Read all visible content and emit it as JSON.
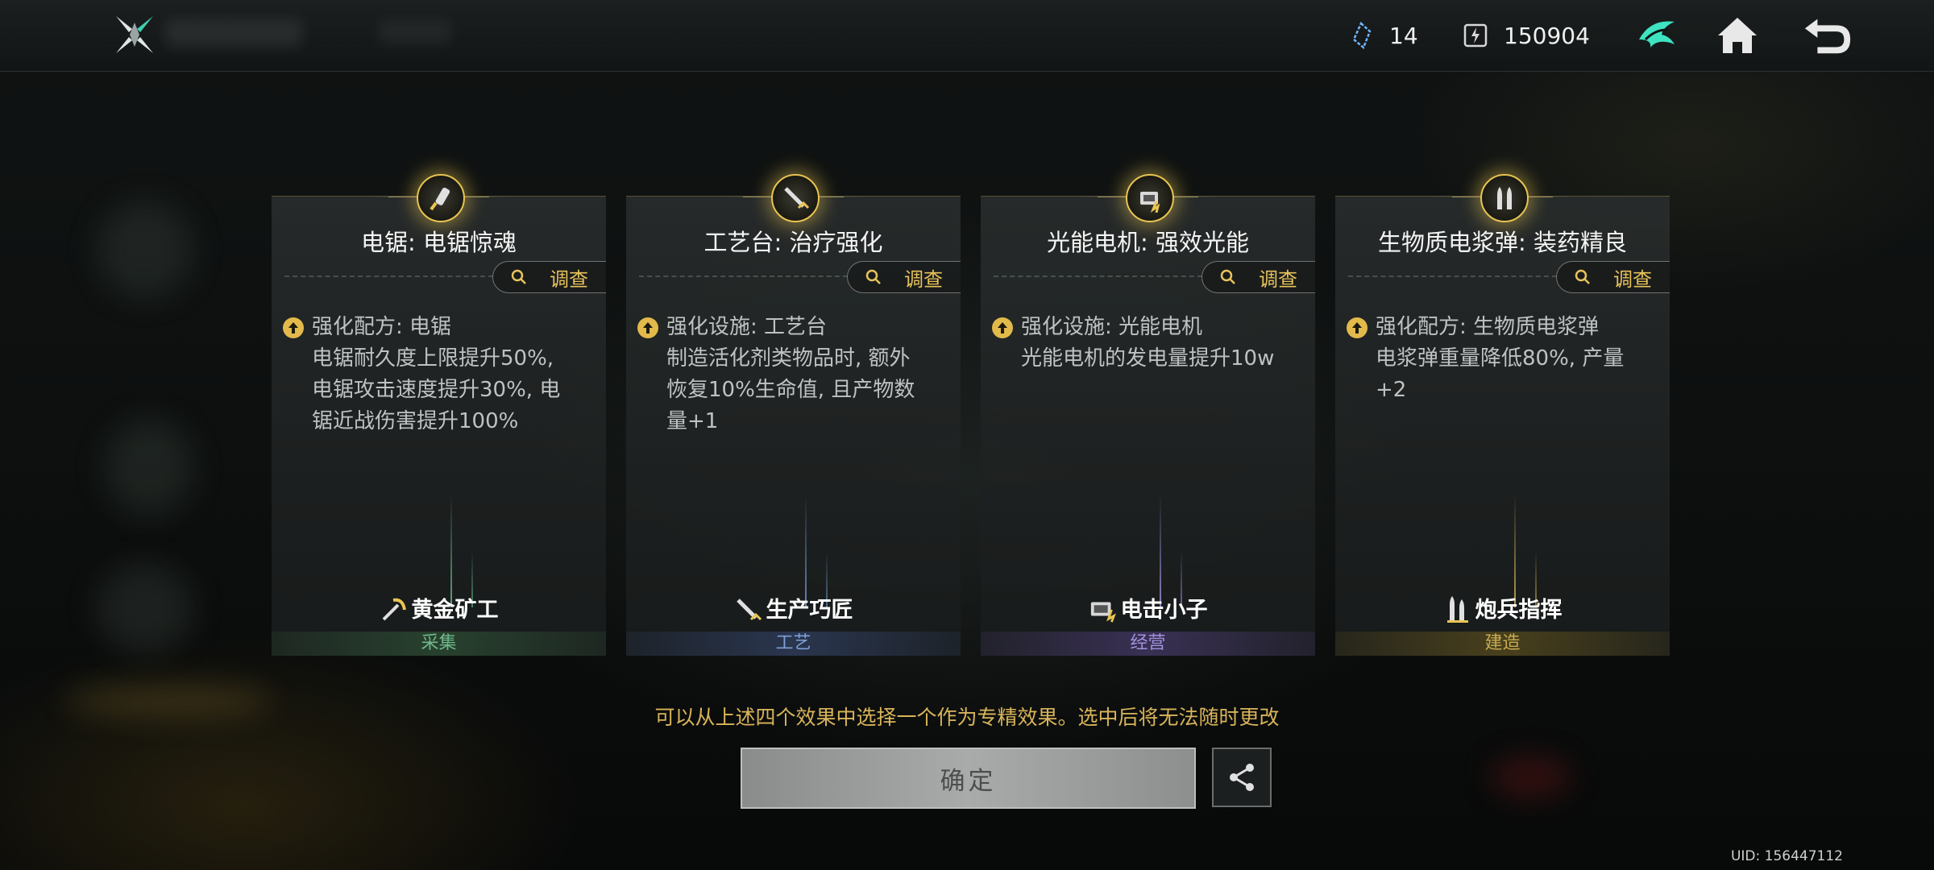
{
  "resources": [
    {
      "icon": "crystal-icon",
      "value": "14"
    },
    {
      "icon": "energy-card-icon",
      "value": "150904"
    }
  ],
  "nav": {
    "profile_icon": "emblem-icon",
    "home_icon": "home-icon",
    "back_icon": "back-arrow-icon"
  },
  "investigate_label": "调查",
  "cards": [
    {
      "title": "电锯: 电锯惊魂",
      "badge_icon": "chainsaw-icon",
      "effect_title": "强化配方: 电锯",
      "effect_body": "电锯耐久度上限提升50%,\n电锯攻击速度提升30%, 电\n锯近战伤害提升100%",
      "job": "黄金矿工",
      "job_icon": "pickaxe-icon",
      "category": "采集",
      "category_color": "#5fae7c"
    },
    {
      "title": "工艺台: 治疗强化",
      "badge_icon": "workbench-icon",
      "effect_title": "强化设施: 工艺台",
      "effect_body": "制造活化剂类物品时, 额外\n恢复10%生命值, 且产物数\n量+1",
      "job": "生产巧匠",
      "job_icon": "wrench-icon",
      "category": "工艺",
      "category_color": "#6f8fc9"
    },
    {
      "title": "光能电机: 强效光能",
      "badge_icon": "motor-icon",
      "effect_title": "强化设施: 光能电机",
      "effect_body": "光能电机的发电量提升10w",
      "job": "电击小子",
      "job_icon": "battery-icon",
      "category": "经营",
      "category_color": "#9a86d6"
    },
    {
      "title": "生物质电浆弹: 装药精良",
      "badge_icon": "bullets-icon",
      "effect_title": "强化配方: 生物质电浆弹",
      "effect_body": "电浆弹重量降低80%, 产量\n+2",
      "job": "炮兵指挥",
      "job_icon": "shells-icon",
      "category": "建造",
      "category_color": "#c2a64a"
    }
  ],
  "hint": "可以从上述四个效果中选择一个作为专精效果。选中后将无法随时更改",
  "confirm_label": "确定",
  "uid": "UID: 156447112"
}
